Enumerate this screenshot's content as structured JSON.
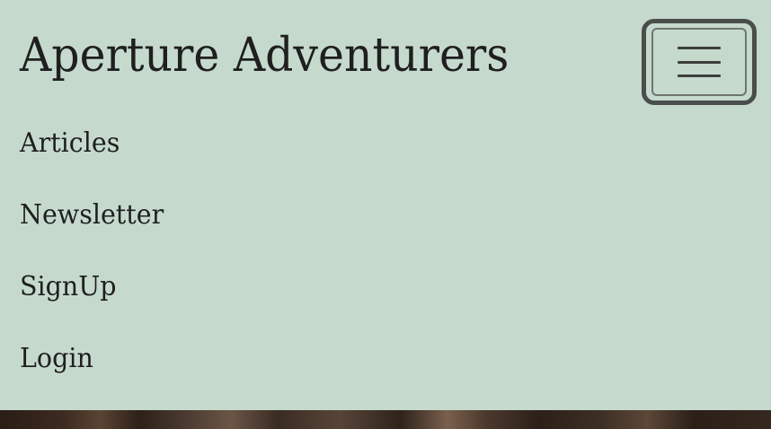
{
  "navbar": {
    "brand": "Aperture Adventurers",
    "toggler_icon": "hamburger-menu-icon",
    "links": [
      {
        "label": "Articles"
      },
      {
        "label": "Newsletter"
      },
      {
        "label": "SignUp"
      },
      {
        "label": "Login"
      }
    ]
  },
  "colors": {
    "navbar_background": "#c5dacd",
    "text": "#1f1f1f",
    "toggler_border": "#4a4e4b"
  }
}
